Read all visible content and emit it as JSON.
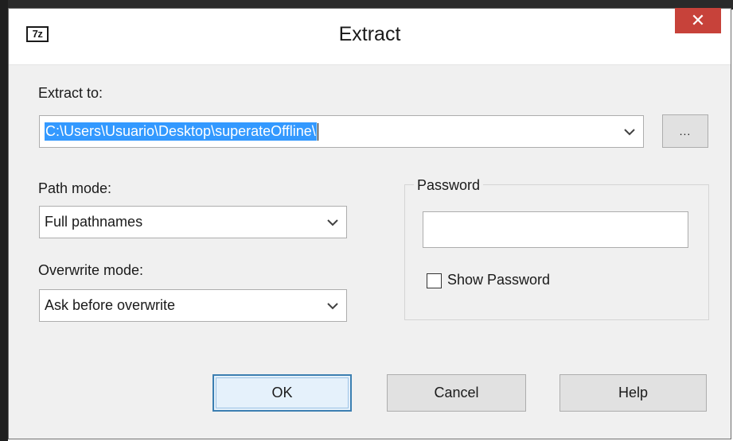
{
  "window": {
    "title": "Extract",
    "app_icon_text": "7z",
    "close_glyph": "✕"
  },
  "extract_to": {
    "label": "Extract to:",
    "value": "C:\\Users\\Usuario\\Desktop\\superateOffline\\",
    "browse_label": "..."
  },
  "path_mode": {
    "label": "Path mode:",
    "value": "Full pathnames"
  },
  "overwrite_mode": {
    "label": "Overwrite mode:",
    "value": "Ask before overwrite"
  },
  "password": {
    "group_label": "Password",
    "value": "",
    "show_password_label": "Show Password",
    "show_password_checked": false
  },
  "buttons": {
    "ok_label": "OK",
    "cancel_label": "Cancel",
    "help_label": "Help"
  },
  "icons": {
    "dropdown": "chevron-down-icon",
    "close": "close-icon",
    "app": "7zip-logo-icon"
  },
  "colors": {
    "close_button": "#c7423a",
    "selection": "#3399ff",
    "default_button_border": "#3c7fb1"
  }
}
